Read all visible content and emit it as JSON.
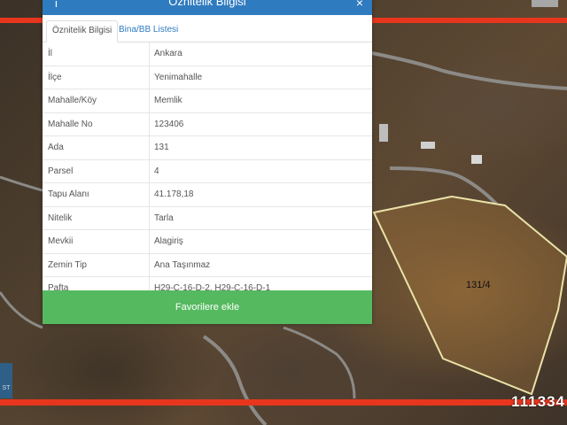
{
  "modal": {
    "title": "Öznitelik Bilgisi",
    "tabs": [
      {
        "label": "Öznitelik Bilgisi",
        "active": true
      },
      {
        "label": "Bina/BB Listesi",
        "active": false
      }
    ],
    "rows": [
      {
        "key": "İl",
        "value": "Ankara"
      },
      {
        "key": "İlçe",
        "value": "Yenimahalle"
      },
      {
        "key": "Mahalle/Köy",
        "value": "Memlik"
      },
      {
        "key": "Mahalle No",
        "value": "123406"
      },
      {
        "key": "Ada",
        "value": "131"
      },
      {
        "key": "Parsel",
        "value": "4"
      },
      {
        "key": "Tapu Alanı",
        "value": "41.178,18"
      },
      {
        "key": "Nitelik",
        "value": "Tarla"
      },
      {
        "key": "Mevkii",
        "value": "Alagiriş"
      },
      {
        "key": "Zemin Tip",
        "value": "Ana Taşınmaz"
      },
      {
        "key": "Pafta",
        "value": "H29-C-16-D-2, H29-C-16-D-1"
      }
    ],
    "favorite_button": "Favorilere ekle"
  },
  "map": {
    "parcel_label": "131/4",
    "corner_text": "ST"
  },
  "listing_code": "111334",
  "colors": {
    "header": "#2f7bbf",
    "button": "#55b95f",
    "red_bar": "#e8361e",
    "parcel_outline": "#e9e2a8"
  }
}
